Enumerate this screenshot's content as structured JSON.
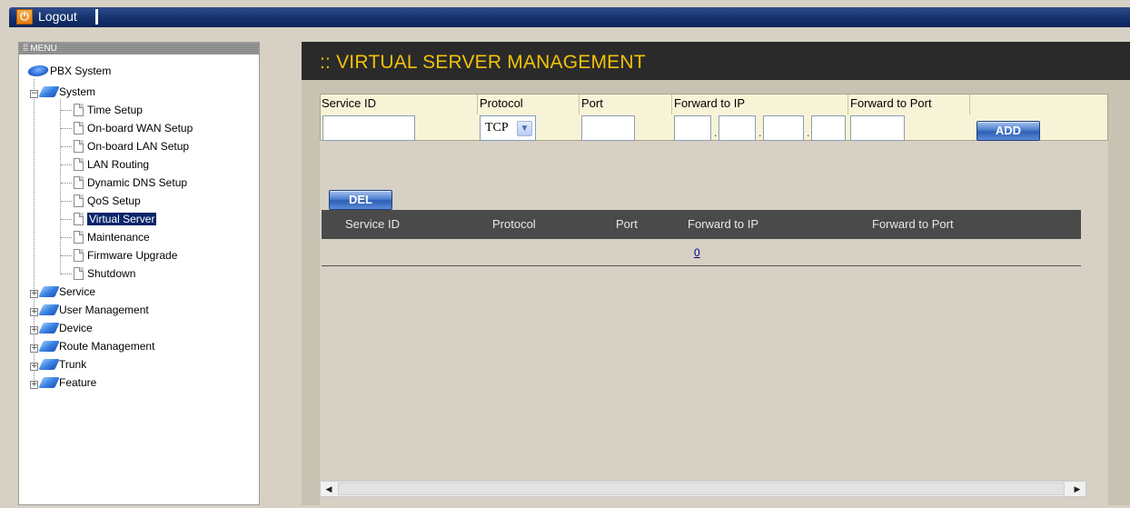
{
  "topbar": {
    "logout_label": "Logout"
  },
  "menu": {
    "header": "MENU",
    "root": "PBX System",
    "system": {
      "label": "System",
      "expander": "−",
      "items": [
        "Time Setup",
        "On-board WAN Setup",
        "On-board LAN Setup",
        "LAN Routing",
        "Dynamic DNS Setup",
        "QoS Setup",
        "Virtual Server",
        "Maintenance",
        "Firmware Upgrade",
        "Shutdown"
      ],
      "selected_item": "Virtual Server"
    },
    "groups": [
      {
        "label": "Service",
        "expander": "+"
      },
      {
        "label": "User Management",
        "expander": "+"
      },
      {
        "label": "Device",
        "expander": "+"
      },
      {
        "label": "Route Management",
        "expander": "+"
      },
      {
        "label": "Trunk",
        "expander": "+"
      },
      {
        "label": "Feature",
        "expander": "+"
      }
    ]
  },
  "page": {
    "title": ":: VIRTUAL SERVER MANAGEMENT"
  },
  "add_form": {
    "headers": {
      "service_id": "Service ID",
      "protocol": "Protocol",
      "port": "Port",
      "forward_ip": "Forward to IP",
      "forward_port": "Forward to Port"
    },
    "values": {
      "service_id": "",
      "protocol": "TCP",
      "port": "",
      "ip1": "",
      "ip2": "",
      "ip3": "",
      "ip4": "",
      "forward_port": ""
    },
    "ip_separator": ".",
    "add_label": "ADD"
  },
  "list": {
    "del_label": "DEL",
    "columns": [
      "Service ID",
      "Protocol",
      "Port",
      "Forward to IP",
      "Forward to Port"
    ],
    "page_link": "0"
  },
  "colors": {
    "title_text": "#f0c20a",
    "title_bg": "#2a2a2a",
    "topbar": "#14306d",
    "button": "#4d7fcf",
    "form_bg": "#f7f3d7"
  }
}
